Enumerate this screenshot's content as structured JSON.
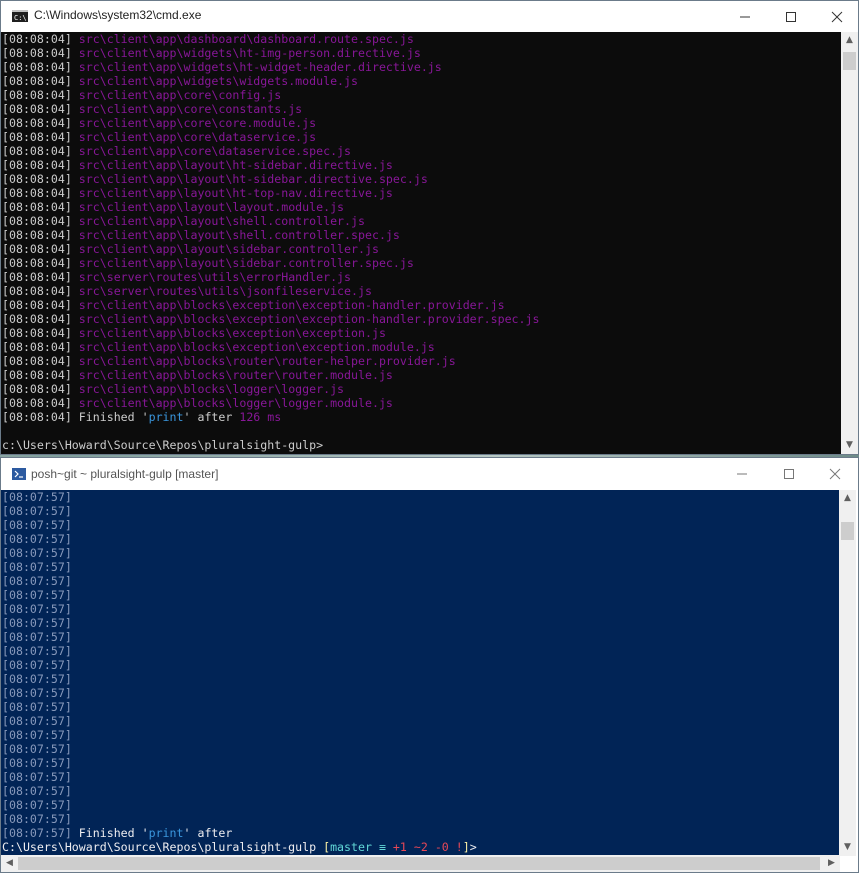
{
  "cmd": {
    "title": "C:\\Windows\\system32\\cmd.exe",
    "lines": [
      {
        "ts": "[08:08:04]",
        "path": "src\\client\\app\\dashboard\\dashboard.route.spec.js"
      },
      {
        "ts": "[08:08:04]",
        "path": "src\\client\\app\\widgets\\ht-img-person.directive.js"
      },
      {
        "ts": "[08:08:04]",
        "path": "src\\client\\app\\widgets\\ht-widget-header.directive.js"
      },
      {
        "ts": "[08:08:04]",
        "path": "src\\client\\app\\widgets\\widgets.module.js"
      },
      {
        "ts": "[08:08:04]",
        "path": "src\\client\\app\\core\\config.js"
      },
      {
        "ts": "[08:08:04]",
        "path": "src\\client\\app\\core\\constants.js"
      },
      {
        "ts": "[08:08:04]",
        "path": "src\\client\\app\\core\\core.module.js"
      },
      {
        "ts": "[08:08:04]",
        "path": "src\\client\\app\\core\\dataservice.js"
      },
      {
        "ts": "[08:08:04]",
        "path": "src\\client\\app\\core\\dataservice.spec.js"
      },
      {
        "ts": "[08:08:04]",
        "path": "src\\client\\app\\layout\\ht-sidebar.directive.js"
      },
      {
        "ts": "[08:08:04]",
        "path": "src\\client\\app\\layout\\ht-sidebar.directive.spec.js"
      },
      {
        "ts": "[08:08:04]",
        "path": "src\\client\\app\\layout\\ht-top-nav.directive.js"
      },
      {
        "ts": "[08:08:04]",
        "path": "src\\client\\app\\layout\\layout.module.js"
      },
      {
        "ts": "[08:08:04]",
        "path": "src\\client\\app\\layout\\shell.controller.js"
      },
      {
        "ts": "[08:08:04]",
        "path": "src\\client\\app\\layout\\shell.controller.spec.js"
      },
      {
        "ts": "[08:08:04]",
        "path": "src\\client\\app\\layout\\sidebar.controller.js"
      },
      {
        "ts": "[08:08:04]",
        "path": "src\\client\\app\\layout\\sidebar.controller.spec.js"
      },
      {
        "ts": "[08:08:04]",
        "path": "src\\server\\routes\\utils\\errorHandler.js"
      },
      {
        "ts": "[08:08:04]",
        "path": "src\\server\\routes\\utils\\jsonfileservice.js"
      },
      {
        "ts": "[08:08:04]",
        "path": "src\\client\\app\\blocks\\exception\\exception-handler.provider.js"
      },
      {
        "ts": "[08:08:04]",
        "path": "src\\client\\app\\blocks\\exception\\exception-handler.provider.spec.js"
      },
      {
        "ts": "[08:08:04]",
        "path": "src\\client\\app\\blocks\\exception\\exception.js"
      },
      {
        "ts": "[08:08:04]",
        "path": "src\\client\\app\\blocks\\exception\\exception.module.js"
      },
      {
        "ts": "[08:08:04]",
        "path": "src\\client\\app\\blocks\\router\\router-helper.provider.js"
      },
      {
        "ts": "[08:08:04]",
        "path": "src\\client\\app\\blocks\\router\\router.module.js"
      },
      {
        "ts": "[08:08:04]",
        "path": "src\\client\\app\\blocks\\logger\\logger.js"
      },
      {
        "ts": "[08:08:04]",
        "path": "src\\client\\app\\blocks\\logger\\logger.module.js"
      }
    ],
    "finished": {
      "ts": "[08:08:04]",
      "pre": " Finished '",
      "task": "print",
      "mid": "' after ",
      "dur": "126 ms"
    },
    "prompt": "c:\\Users\\Howard\\Source\\Repos\\pluralsight-gulp>"
  },
  "posh": {
    "title": "posh~git ~ pluralsight-gulp [master]",
    "ts_lines": [
      "[08:07:57]",
      "[08:07:57]",
      "[08:07:57]",
      "[08:07:57]",
      "[08:07:57]",
      "[08:07:57]",
      "[08:07:57]",
      "[08:07:57]",
      "[08:07:57]",
      "[08:07:57]",
      "[08:07:57]",
      "[08:07:57]",
      "[08:07:57]",
      "[08:07:57]",
      "[08:07:57]",
      "[08:07:57]",
      "[08:07:57]",
      "[08:07:57]",
      "[08:07:57]",
      "[08:07:57]",
      "[08:07:57]",
      "[08:07:57]",
      "[08:07:57]",
      "[08:07:57]"
    ],
    "finished": {
      "ts": "[08:07:57]",
      "pre": " Finished '",
      "task": "print",
      "post": "' after"
    },
    "prompt": {
      "path": "C:\\Users\\Howard\\Source\\Repos\\pluralsight-gulp ",
      "open": "[",
      "branch": "master",
      "sym": " ≡",
      "add": " +1",
      "mod": " ~2",
      "del": " -0",
      "bang": " !",
      "close": "]",
      "gt": ">"
    }
  }
}
